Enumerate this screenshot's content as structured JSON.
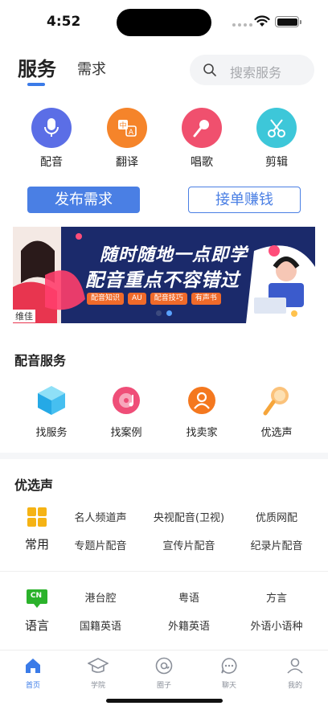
{
  "status": {
    "time": "4:52"
  },
  "tabs": {
    "service": "服务",
    "demand": "需求"
  },
  "search": {
    "placeholder": "搜索服务"
  },
  "categories": [
    {
      "label": "配音",
      "icon": "microphone-icon",
      "color": "#5b6ee6"
    },
    {
      "label": "翻译",
      "icon": "translate-icon",
      "color": "#f5842a"
    },
    {
      "label": "唱歌",
      "icon": "singing-mic-icon",
      "color": "#f0506e"
    },
    {
      "label": "剪辑",
      "icon": "scissors-icon",
      "color": "#3dc7d9"
    }
  ],
  "actions": {
    "publish": "发布需求",
    "order": "接单赚钱"
  },
  "banner": {
    "line1": "随时随地一点即学",
    "line2": "配音重点不容错过",
    "tags": [
      "配音知识",
      "AU",
      "配音技巧",
      "有声书"
    ],
    "person_label": "维佳"
  },
  "dubbing_service": {
    "title": "配音服务",
    "items": [
      {
        "label": "找服务",
        "icon": "cube-icon"
      },
      {
        "label": "找案例",
        "icon": "music-disc-icon"
      },
      {
        "label": "找卖家",
        "icon": "seller-icon"
      },
      {
        "label": "优选声",
        "icon": "mic-voice-icon"
      }
    ]
  },
  "preferred_voices": {
    "title": "优选声",
    "groups": [
      {
        "label": "常用",
        "icon": "grid-icon",
        "cells": [
          "名人频道声",
          "央视配音(卫视)",
          "优质网配",
          "专题片配音",
          "宣传片配音",
          "纪录片配音"
        ]
      },
      {
        "label": "语言",
        "icon": "cn-language-icon",
        "icon_text": "CN",
        "cells": [
          "港台腔",
          "粤语",
          "方言",
          "国籍英语",
          "外籍英语",
          "外语小语种"
        ]
      }
    ]
  },
  "tab_bar": [
    {
      "label": "首页",
      "icon": "home-icon",
      "active": true
    },
    {
      "label": "学院",
      "icon": "graduation-cap-icon",
      "active": false
    },
    {
      "label": "圈子",
      "icon": "circle-at-icon",
      "active": false
    },
    {
      "label": "聊天",
      "icon": "chat-icon",
      "active": false
    },
    {
      "label": "我的",
      "icon": "profile-icon",
      "active": false
    }
  ],
  "colors": {
    "accent": "#3b7be8",
    "button": "#4a7fe4"
  }
}
